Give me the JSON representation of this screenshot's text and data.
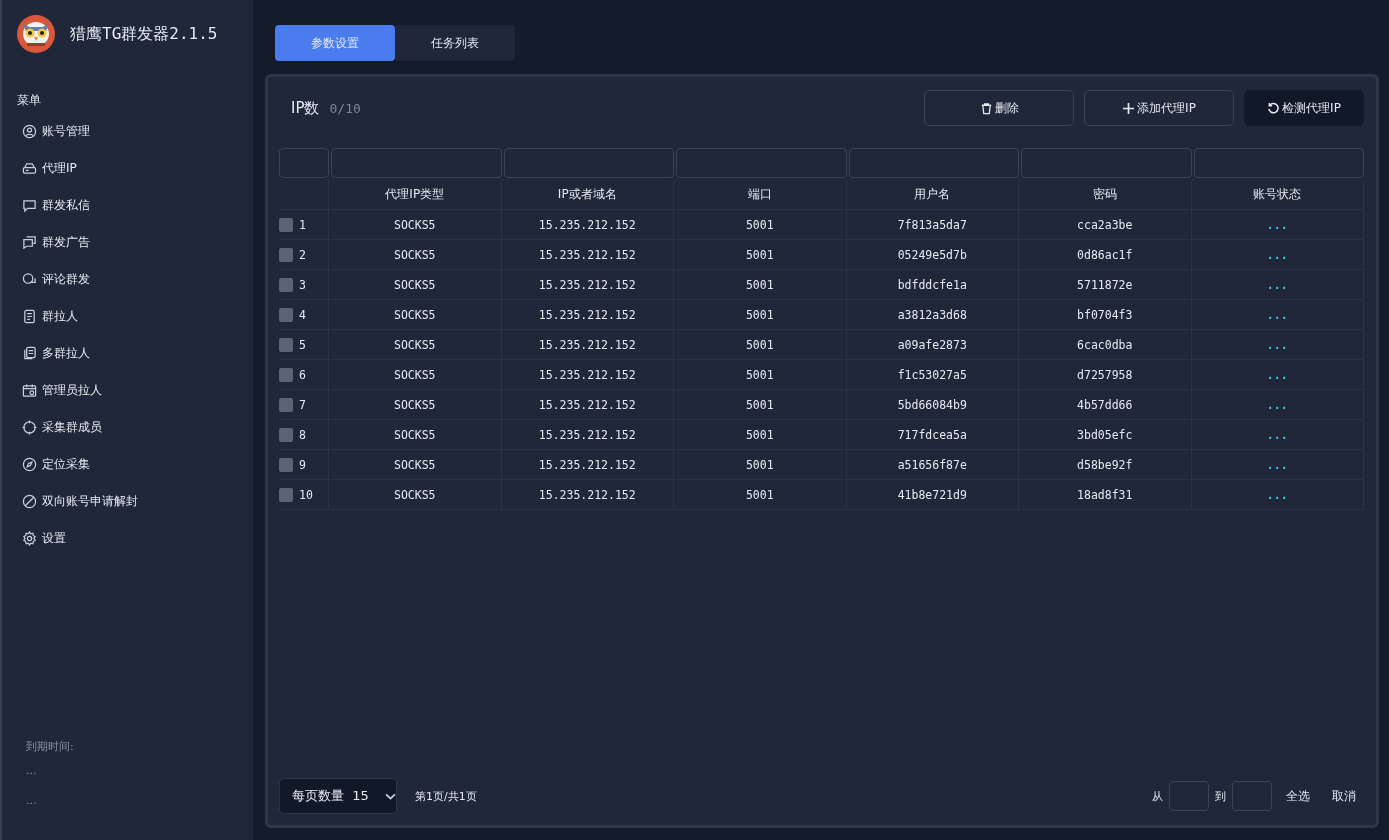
{
  "app": {
    "title": "猎鹰TG群发器2.1.5"
  },
  "sidebar": {
    "heading": "菜单",
    "items": [
      {
        "label": "账号管理"
      },
      {
        "label": "代理IP"
      },
      {
        "label": "群发私信"
      },
      {
        "label": "群发广告"
      },
      {
        "label": "评论群发"
      },
      {
        "label": "群拉人"
      },
      {
        "label": "多群拉人"
      },
      {
        "label": "管理员拉人"
      },
      {
        "label": "采集群成员"
      },
      {
        "label": "定位采集"
      },
      {
        "label": "双向账号申请解封"
      },
      {
        "label": "设置"
      }
    ],
    "expiry_label": "到期时间:",
    "expiry_lines": [
      "...",
      "..."
    ]
  },
  "tabs": [
    {
      "label": "参数设置",
      "selected": true
    },
    {
      "label": "任务列表",
      "selected": false
    }
  ],
  "toolbar": {
    "title": "IP数",
    "count": "0/10",
    "buttons": [
      {
        "label": "删除",
        "primary": false
      },
      {
        "label": "添加代理IP",
        "primary": false
      },
      {
        "label": "检测代理IP",
        "primary": true
      }
    ]
  },
  "table": {
    "columns": [
      "代理IP类型",
      "IP或者域名",
      "端口",
      "用户名",
      "密码",
      "账号状态"
    ],
    "rows": [
      {
        "index": "1",
        "checked": false,
        "cells": [
          "SOCKS5",
          "15.235.212.152",
          "5001",
          "7f813a5da7",
          "cca2a3be",
          "..."
        ]
      },
      {
        "index": "2",
        "checked": false,
        "cells": [
          "SOCKS5",
          "15.235.212.152",
          "5001",
          "05249e5d7b",
          "0d86ac1f",
          "..."
        ]
      },
      {
        "index": "3",
        "checked": false,
        "cells": [
          "SOCKS5",
          "15.235.212.152",
          "5001",
          "bdfddcfe1a",
          "5711872e",
          "..."
        ]
      },
      {
        "index": "4",
        "checked": false,
        "cells": [
          "SOCKS5",
          "15.235.212.152",
          "5001",
          "a3812a3d68",
          "bf0704f3",
          "..."
        ]
      },
      {
        "index": "5",
        "checked": false,
        "cells": [
          "SOCKS5",
          "15.235.212.152",
          "5001",
          "a09afe2873",
          "6cac0dba",
          "..."
        ]
      },
      {
        "index": "6",
        "checked": false,
        "cells": [
          "SOCKS5",
          "15.235.212.152",
          "5001",
          "f1c53027a5",
          "d7257958",
          "..."
        ]
      },
      {
        "index": "7",
        "checked": false,
        "cells": [
          "SOCKS5",
          "15.235.212.152",
          "5001",
          "5bd66084b9",
          "4b57dd66",
          "..."
        ]
      },
      {
        "index": "8",
        "checked": false,
        "cells": [
          "SOCKS5",
          "15.235.212.152",
          "5001",
          "717fdcea5a",
          "3bd05efc",
          "..."
        ]
      },
      {
        "index": "9",
        "checked": false,
        "cells": [
          "SOCKS5",
          "15.235.212.152",
          "5001",
          "a51656f87e",
          "d58be92f",
          "..."
        ]
      },
      {
        "index": "10",
        "checked": false,
        "cells": [
          "SOCKS5",
          "15.235.212.152",
          "5001",
          "41b8e721d9",
          "18ad8f31",
          "..."
        ]
      }
    ]
  },
  "footer": {
    "page_size_label": "每页数量",
    "page_size": "15",
    "page_info": "第1页/共1页",
    "from_label": "从",
    "to_label": "到",
    "select_all": "全选",
    "cancel": "取消"
  }
}
